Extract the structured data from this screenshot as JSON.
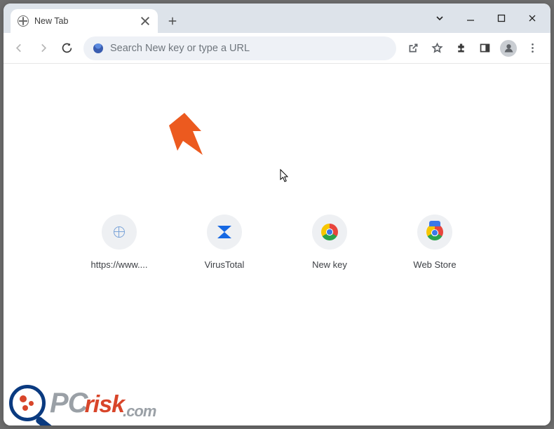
{
  "titlebar": {
    "tab_title": "New Tab"
  },
  "toolbar": {
    "omnibox_placeholder": "Search New key or type a URL"
  },
  "shortcuts": [
    {
      "label": "https://www...."
    },
    {
      "label": "VirusTotal"
    },
    {
      "label": "New key"
    },
    {
      "label": "Web Store"
    }
  ],
  "watermark": {
    "part1": "PC",
    "part2": "risk",
    "part3": ".com"
  }
}
